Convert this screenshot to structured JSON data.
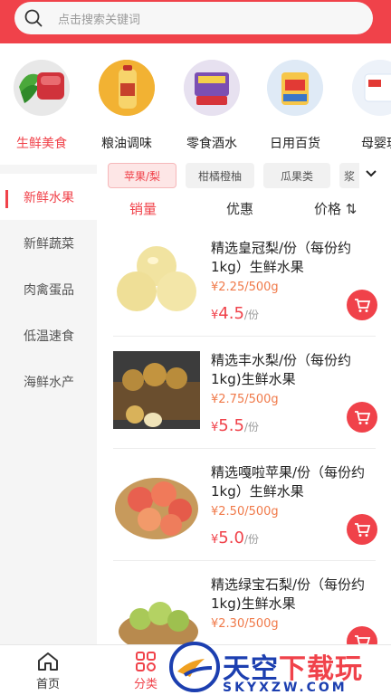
{
  "search": {
    "placeholder": "点击搜索关键词"
  },
  "categories": [
    {
      "label": "生鲜美食",
      "icon": "fresh-food-icon",
      "active": true
    },
    {
      "label": "粮油调味",
      "icon": "grain-oil-icon"
    },
    {
      "label": "零食酒水",
      "icon": "snacks-icon"
    },
    {
      "label": "日用百货",
      "icon": "daily-goods-icon"
    },
    {
      "label": "母婴玩",
      "icon": "baby-icon"
    }
  ],
  "sidebar": {
    "items": [
      {
        "label": "新鲜水果",
        "active": true
      },
      {
        "label": "新鲜蔬菜"
      },
      {
        "label": "肉禽蛋品"
      },
      {
        "label": "低温速食"
      },
      {
        "label": "海鲜水产"
      }
    ]
  },
  "subtabs": {
    "items": [
      "苹果/梨",
      "柑橘橙柚",
      "瓜果类",
      "浆"
    ],
    "more_icon": "chevron-down-icon"
  },
  "sort": {
    "sales": "销量",
    "discount": "优惠",
    "price": "价格 ⇅"
  },
  "products": [
    {
      "name": "精选皇冠梨/份（每份约1kg）生鲜水果",
      "unit_price": "¥2.25/500g",
      "currency": "¥",
      "price": "4.5",
      "per": "/份",
      "image": "pear-icon"
    },
    {
      "name": "精选丰水梨/份（每份约1kg)生鲜水果",
      "unit_price": "¥2.75/500g",
      "currency": "¥",
      "price": "5.5",
      "per": "/份",
      "image": "asian-pear-icon"
    },
    {
      "name": "精选嘎啦苹果/份（每份约1kg）生鲜水果",
      "unit_price": "¥2.50/500g",
      "currency": "¥",
      "price": "5.0",
      "per": "/份",
      "image": "apple-icon"
    },
    {
      "name": "精选绿宝石梨/份（每份约1kg)生鲜水果",
      "unit_price": "¥2.30/500g",
      "currency": "¥",
      "price": "",
      "per": "",
      "image": "green-pear-icon"
    }
  ],
  "bottom_nav": {
    "home": "首页",
    "category": "分类"
  },
  "watermark": {
    "title_blue": "天空",
    "title_red": "下载玩",
    "sub": "SKYXZW.COM"
  },
  "colors": {
    "accent": "#f0424a",
    "unit_price": "#f07a4a",
    "watermark": "#1c3fb0"
  }
}
